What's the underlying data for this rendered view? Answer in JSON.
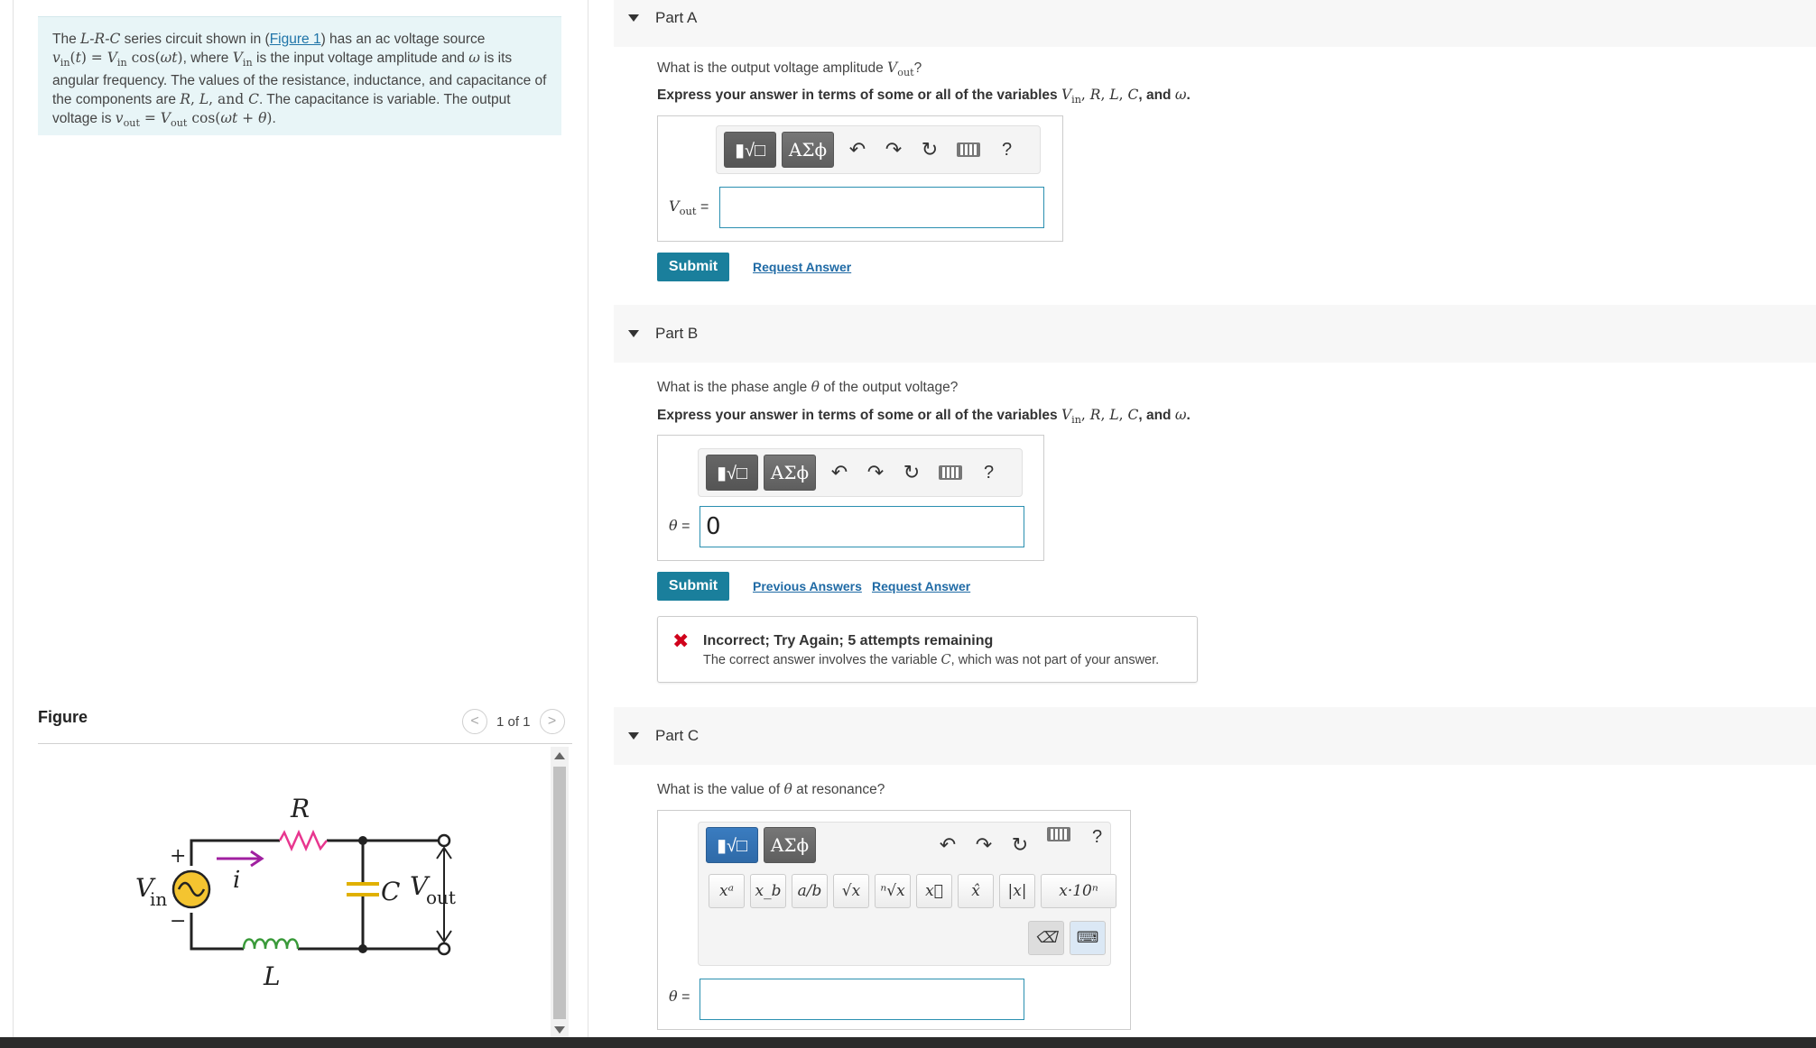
{
  "problem": {
    "intro": "The ",
    "circuit_name": "L-R-C",
    "after_name": " series circuit shown in (",
    "figure_link": "Figure 1",
    "after_link": ") has an ac voltage source",
    "line2_mid": ", where ",
    "line2_end": " is the input voltage amplitude and ",
    "omega": "ω",
    "line2_tail": " is its",
    "line3": "angular frequency. The values of the resistance, inductance, and capacitance of",
    "line4_a": "the components are ",
    "line4_b": ". The capacitance is variable. The output",
    "line5": "voltage is "
  },
  "figure": {
    "label": "Figure",
    "pager": "1 of 1",
    "prev": "<",
    "next": ">",
    "labels": {
      "R": "R",
      "L": "L",
      "C": "C",
      "i": "i",
      "Vin": "V",
      "Vin_sub": "in",
      "Vout": "V",
      "Vout_sub": "out",
      "plus": "+",
      "minus": "−"
    }
  },
  "partA": {
    "header": "Part A",
    "question_pre": "What is the output voltage amplitude ",
    "question_post": "?",
    "instruction": "Express your answer in terms of some or all of the variables ",
    "var_and": ", and ",
    "label_sub": "out",
    "label_eq": " =",
    "input_value": "",
    "submit": "Submit",
    "request": "Request Answer"
  },
  "partB": {
    "header": "Part B",
    "question_pre": "What is the phase angle ",
    "question_post": " of the output voltage?",
    "instruction": "Express your answer in terms of some or all of the variables ",
    "label_eq": " =",
    "input_value": "0",
    "submit": "Submit",
    "previous": "Previous Answers",
    "request": "Request Answer",
    "feedback_title": "Incorrect; Try Again; 5 attempts remaining",
    "feedback_msg_pre": "The correct answer involves the variable ",
    "feedback_msg_var": "C",
    "feedback_msg_post": ", which was not part of your answer."
  },
  "partC": {
    "header": "Part C",
    "question_pre": "What is the value of ",
    "question_post": " at resonance?",
    "label_eq": " =",
    "input_value": ""
  },
  "toolbar": {
    "greek": "ΑΣϕ",
    "undo": "↶",
    "redo": "↷",
    "reset": "↻",
    "help": "?"
  },
  "symbols": [
    "xᵃ",
    "x_b",
    "a/b",
    "√x",
    "ⁿ√x",
    "x⃗",
    "x̂",
    "|x|",
    "x·10ⁿ"
  ],
  "colors": {
    "accent": "#1a7f9c",
    "error": "#d0021b",
    "problem_bg": "#e8f5f7",
    "resistor": "#e8368f",
    "current_arrow": "#a020a0"
  }
}
